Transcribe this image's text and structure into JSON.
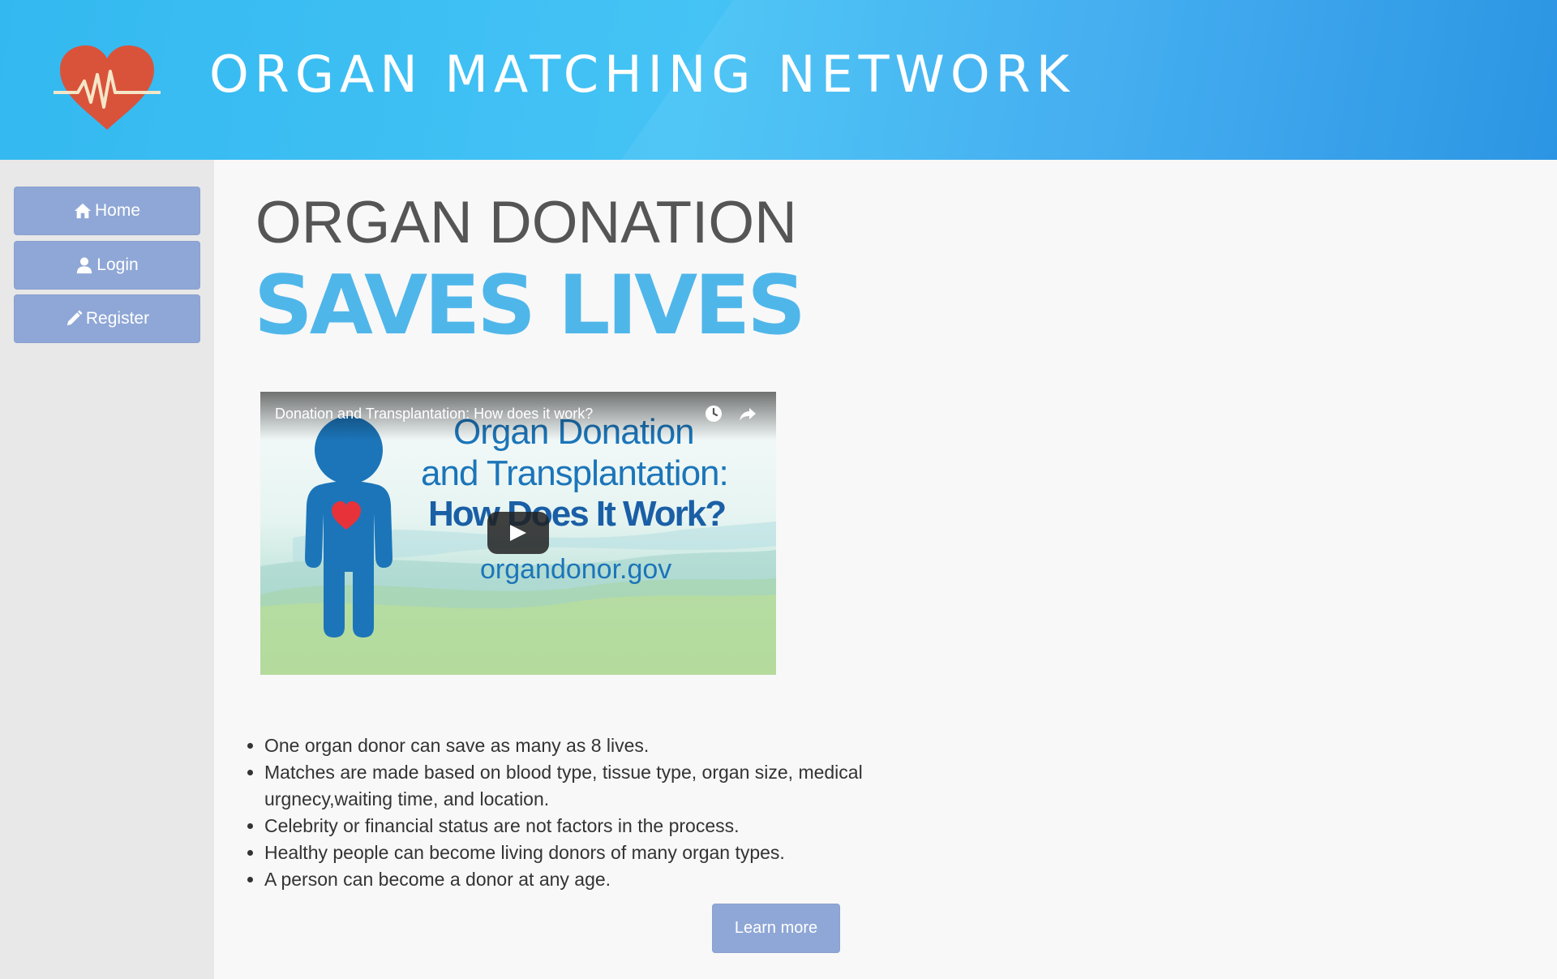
{
  "header": {
    "site_title": "ORGAN MATCHING NETWORK",
    "logo_icon": "heart-pulse-icon",
    "colors": {
      "gradient_start": "#33b9f0",
      "gradient_end": "#1f8fe2",
      "logo_heart": "#d9533b"
    }
  },
  "sidebar": {
    "items": [
      {
        "label": "Home",
        "icon": "home-icon"
      },
      {
        "label": "Login",
        "icon": "user-icon"
      },
      {
        "label": "Register",
        "icon": "pencil-icon"
      }
    ],
    "button_color": "#8fa7d6"
  },
  "main": {
    "headline_line1": "ORGAN DONATION",
    "headline_line2": "SAVES LIVES",
    "headline_accent_color": "#4fb6ea",
    "video": {
      "title": "Donation and Transplantation: How does it work?",
      "thumbnail_line1": "Organ Donation",
      "thumbnail_line2": "and Transplantation:",
      "thumbnail_line3": "How Does It Work?",
      "thumbnail_line4": "organdonor.gov",
      "icons": [
        "watch-later-icon",
        "share-icon",
        "play-icon"
      ]
    },
    "facts": [
      "One organ donor can save as many as 8 lives.",
      "Matches are made based on blood type, tissue type, organ size, medical urgnecy,waiting time, and location.",
      "Celebrity or financial status are not factors in the process.",
      "Healthy people can become living donors of many organ types.",
      "A person can become a donor at any age."
    ],
    "learn_more_label": "Learn more"
  }
}
